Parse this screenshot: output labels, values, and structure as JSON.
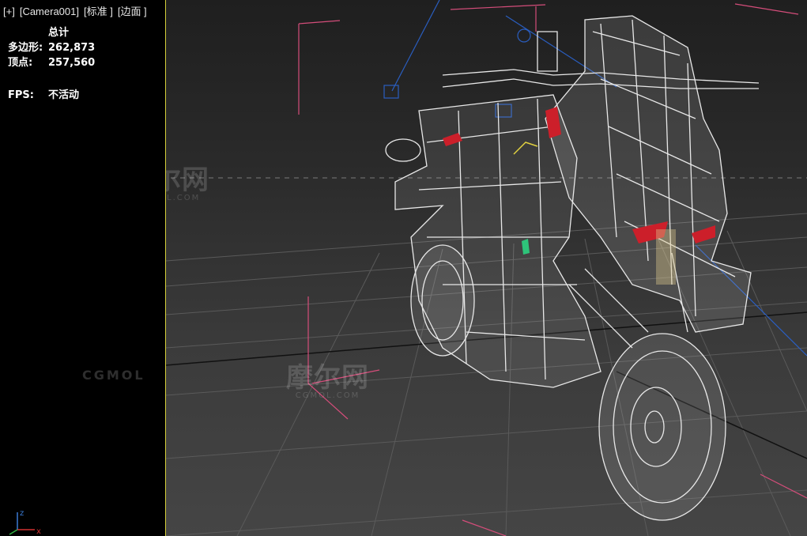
{
  "viewport": {
    "labels": [
      "[+]",
      "[Camera001]",
      "[标准 ]",
      "[边面 ]"
    ]
  },
  "stats": {
    "header": "总计",
    "polygons_label": "多边形:",
    "polygons_value": "262,873",
    "vertices_label": "顶点:",
    "vertices_value": "257,560",
    "fps_label": "FPS:",
    "fps_value": "不活动"
  },
  "watermarks": {
    "logo_text": "摩尔网",
    "logo_sub": "CGMOL.COM",
    "side_text": "CGMOL"
  },
  "axis": {
    "z": "z",
    "x": "x"
  },
  "colors": {
    "left_panel_border": "#d6d03a",
    "wireframe": "#e8e8e8",
    "accent_red": "#cc1f2a",
    "gizmo_pink": "#d44d7a",
    "gizmo_blue": "#2a5ec0"
  }
}
